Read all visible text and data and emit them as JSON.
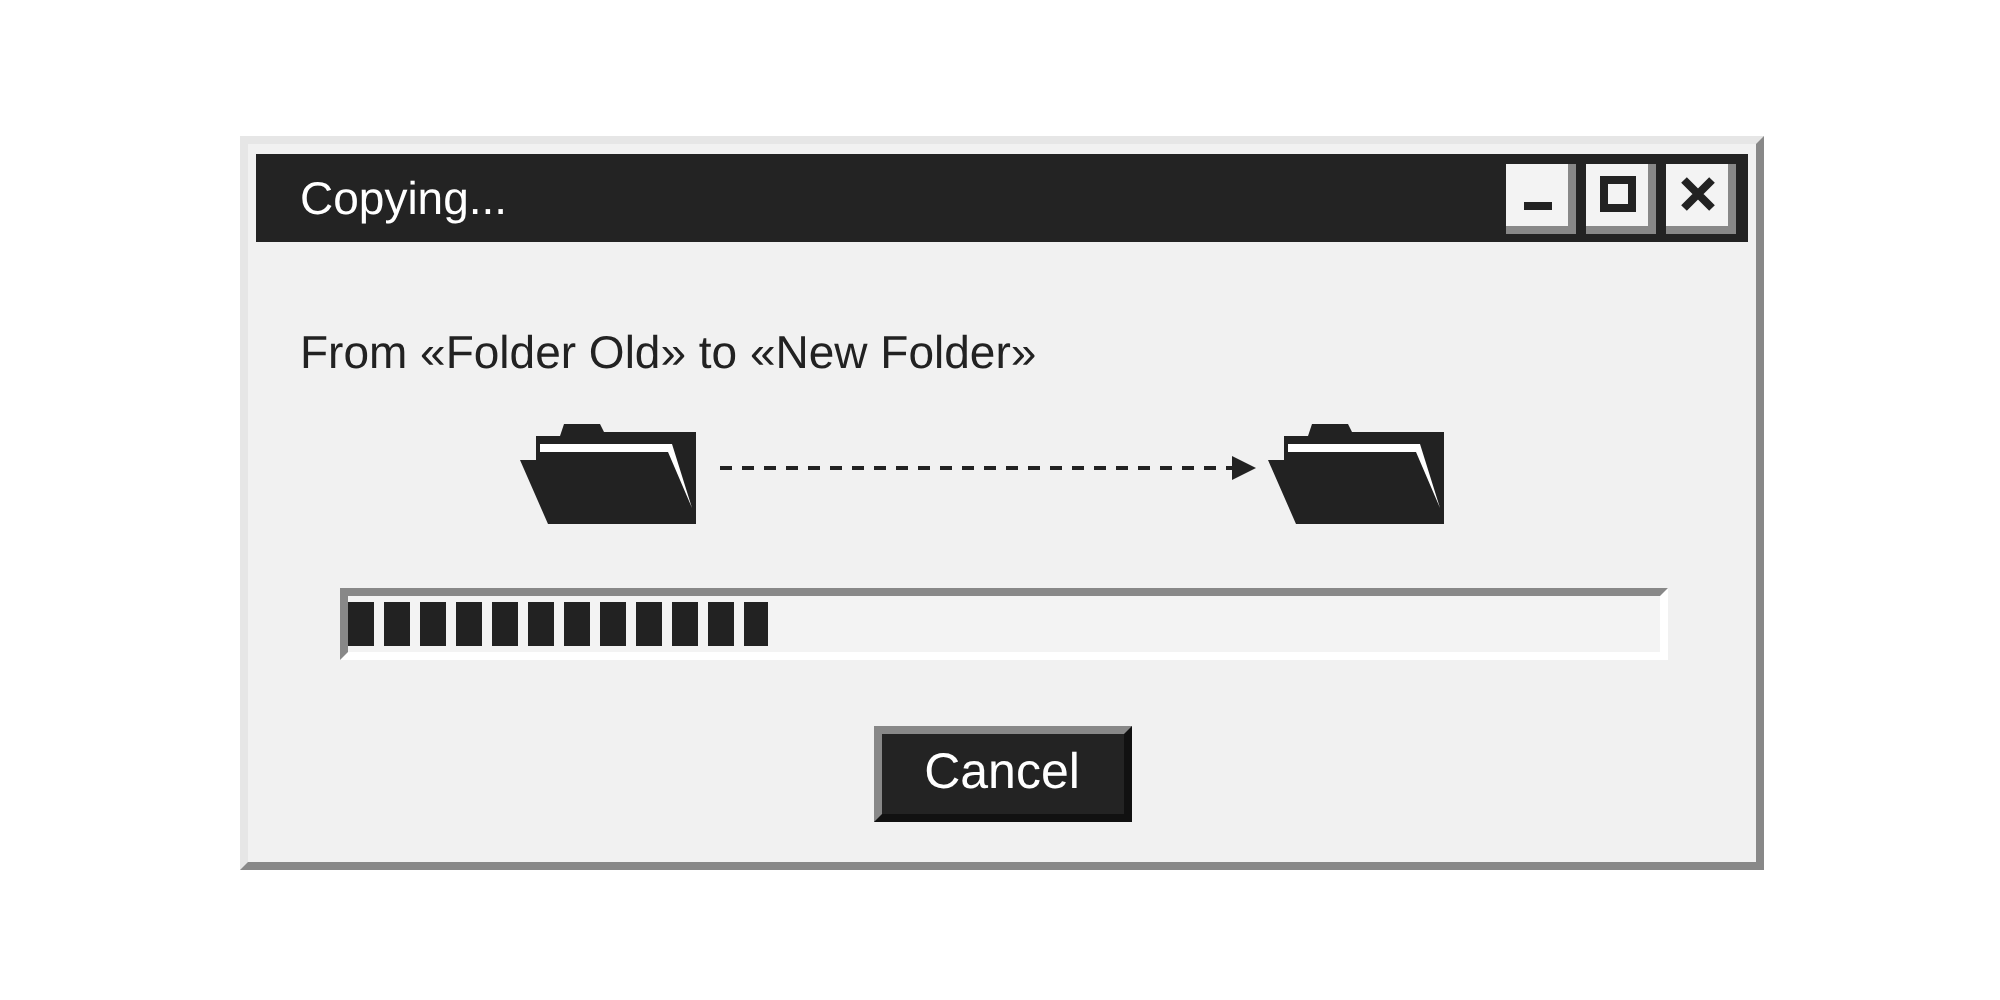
{
  "window": {
    "title": "Copying..."
  },
  "message": "From «Folder Old» to «New Folder»",
  "progress": {
    "level": 0.32
  },
  "buttons": [
    "Cancel"
  ]
}
